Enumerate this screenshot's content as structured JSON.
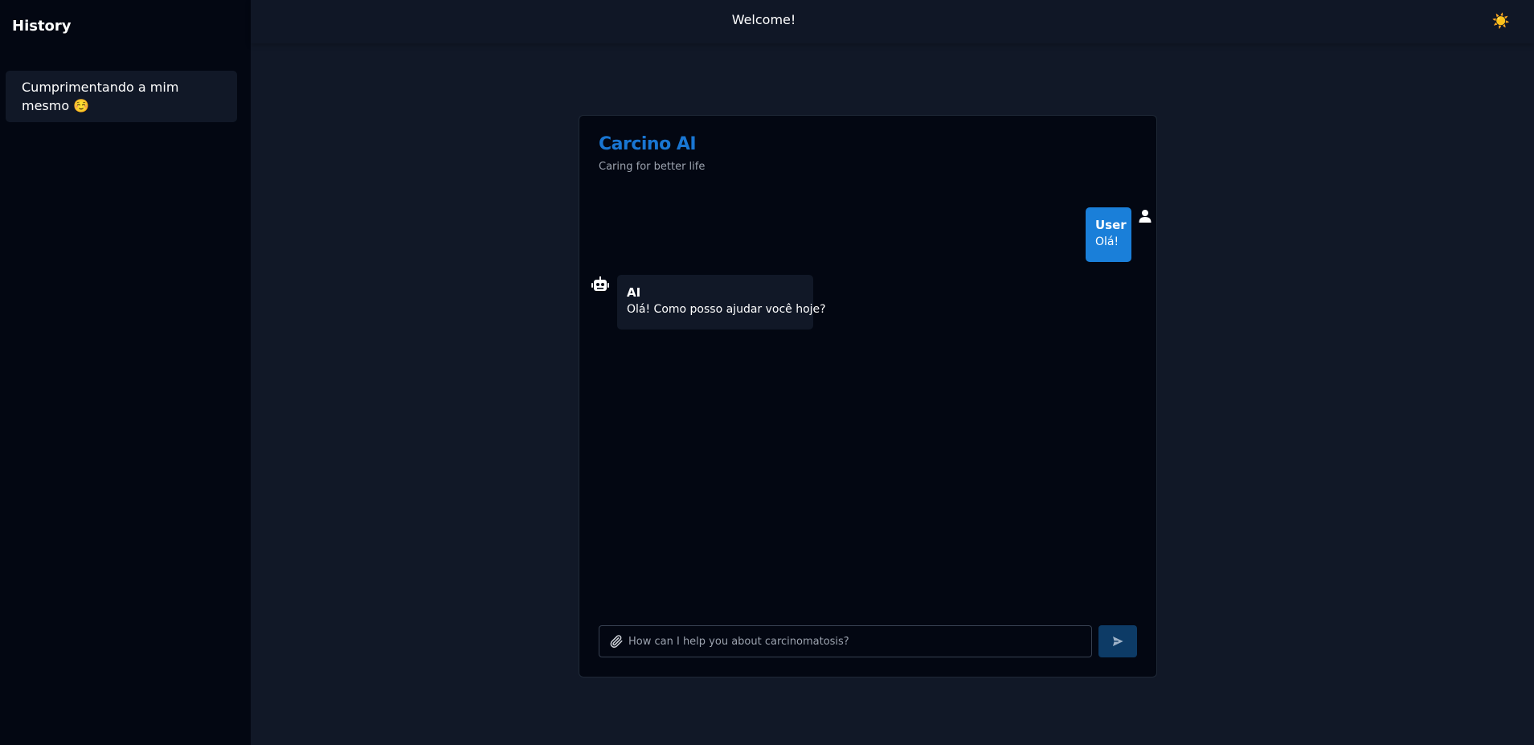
{
  "sidebar": {
    "title": "History",
    "items": [
      {
        "label": "Cumprimentando a mim mesmo ☺️"
      }
    ]
  },
  "header": {
    "welcome": "Welcome!",
    "theme_icon": "sun-icon",
    "theme_glyph": "☀️"
  },
  "chat": {
    "title": "Carcino AI",
    "subtitle": "Caring for better life",
    "messages": [
      {
        "role": "user",
        "name": "User",
        "text": "Olá!",
        "icon": "user-icon"
      },
      {
        "role": "ai",
        "name": "AI",
        "text": "Olá! Como posso ajudar você hoje?",
        "icon": "robot-icon"
      }
    ],
    "input": {
      "placeholder": "How can I help you about carcinomatosis?",
      "value": ""
    },
    "attach_icon": "paperclip-icon",
    "send_icon": "send-icon"
  },
  "colors": {
    "accent": "#1976d2",
    "user_bubble": "#1a7fd9",
    "send_button": "#0d3b66",
    "background": "#111827",
    "sidebar_bg": "#030712"
  }
}
